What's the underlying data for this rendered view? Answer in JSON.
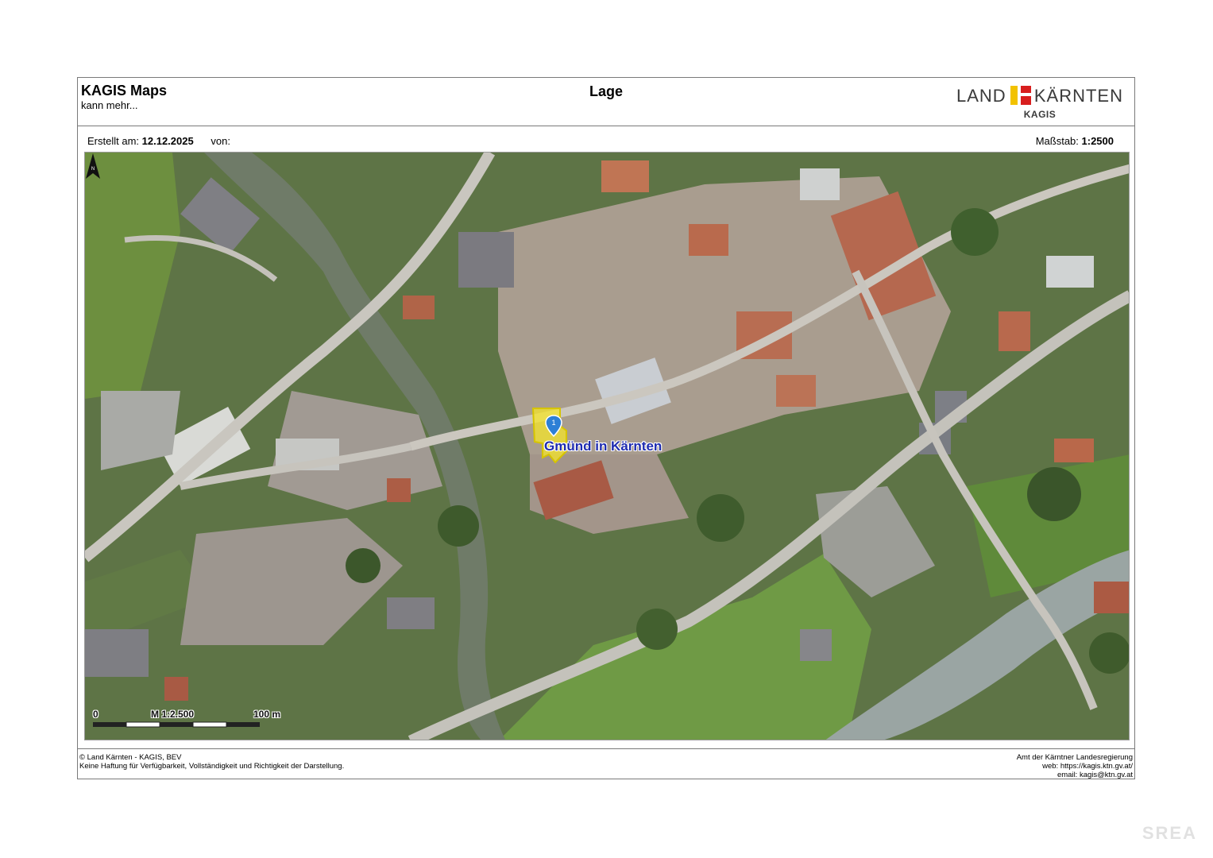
{
  "header": {
    "brand_title": "KAGIS Maps",
    "brand_subtitle": "kann mehr...",
    "document_title": "Lage",
    "logo": {
      "word_left": "LAND",
      "word_right": "KÄRNTEN",
      "subtitle": "KAGIS",
      "colors": [
        "#f2c200",
        "#d81e1e"
      ]
    }
  },
  "meta": {
    "created_label": "Erstellt am:",
    "created_date": "12.12.2025",
    "by_label": "von:",
    "by_value": "",
    "scale_label": "Maßstab:",
    "scale_value": "1:2500"
  },
  "map": {
    "type": "aerial orthophoto",
    "place_label": "Gmünd in Kärnten",
    "marker_label": "1",
    "marker_color": "#2d7fd6",
    "parcel_highlight_color": "#f5e62a",
    "scalebar": {
      "start": "0",
      "middle": "M 1:2.500",
      "end": "100 m"
    },
    "north_arrow": "N"
  },
  "footer": {
    "left_line1": "© Land Kärnten - KAGIS, BEV",
    "left_line2": "Keine Haftung für Verfügbarkeit, Vollständigkeit und Richtigkeit der Darstellung.",
    "right_line1": "Amt der Kärntner Landesregierung",
    "right_line2": "web: https://kagis.ktn.gv.at/",
    "right_line3": "email: kagis@ktn.gv.at"
  },
  "watermark": "SREA"
}
